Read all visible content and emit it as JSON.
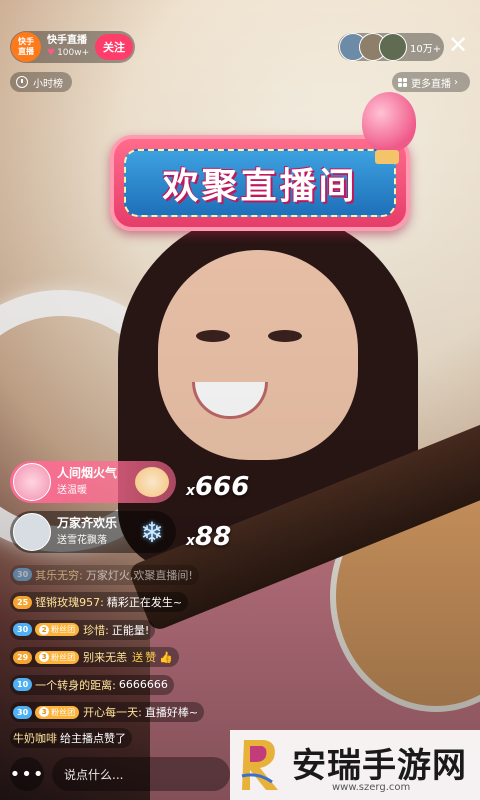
{
  "anchor": {
    "logo_text": "快手\n直播",
    "name": "快手直播",
    "likes": "100w+",
    "follow_label": "关注"
  },
  "viewers": {
    "count": "10万+"
  },
  "hour_rank": {
    "label": "小时榜"
  },
  "more_live": {
    "label": "更多直播"
  },
  "banner": {
    "title": "欢聚直播间"
  },
  "gifts": [
    {
      "user": "人间烟火气",
      "action": "送温暖",
      "icon": "cat-gift-icon",
      "count": "666",
      "x": "x"
    },
    {
      "user": "万家齐欢乐",
      "action": "送雪花飘落",
      "icon": "snowflake-icon",
      "count": "88",
      "x": "x"
    }
  ],
  "comments": [
    {
      "level": "30",
      "user": "其乐无穷:",
      "text": "万家灯火,欢聚直播间!"
    },
    {
      "level": "25",
      "user": "铿锵玫瑰957:",
      "text": "精彩正在发生~"
    },
    {
      "level": "30",
      "fan_level": "2",
      "fan_label": "粉丝团",
      "user": "珍惜:",
      "text": "正能量!"
    },
    {
      "level": "29",
      "fan_level": "3",
      "fan_label": "粉丝团",
      "user": "别来无恙",
      "text": "送",
      "gift": "赞"
    },
    {
      "level": "10",
      "user": "一个转身的距离:",
      "text": "6666666"
    },
    {
      "level": "30",
      "fan_level": "3",
      "fan_label": "粉丝团",
      "user": "开心每一天:",
      "text": "直播好棒~"
    },
    {
      "user": "牛奶咖啡",
      "text": "给主播点赞了"
    }
  ],
  "input": {
    "placeholder": "说点什么..."
  },
  "watermark": {
    "title": "安瑞手游网",
    "url": "www.szerg.com"
  }
}
